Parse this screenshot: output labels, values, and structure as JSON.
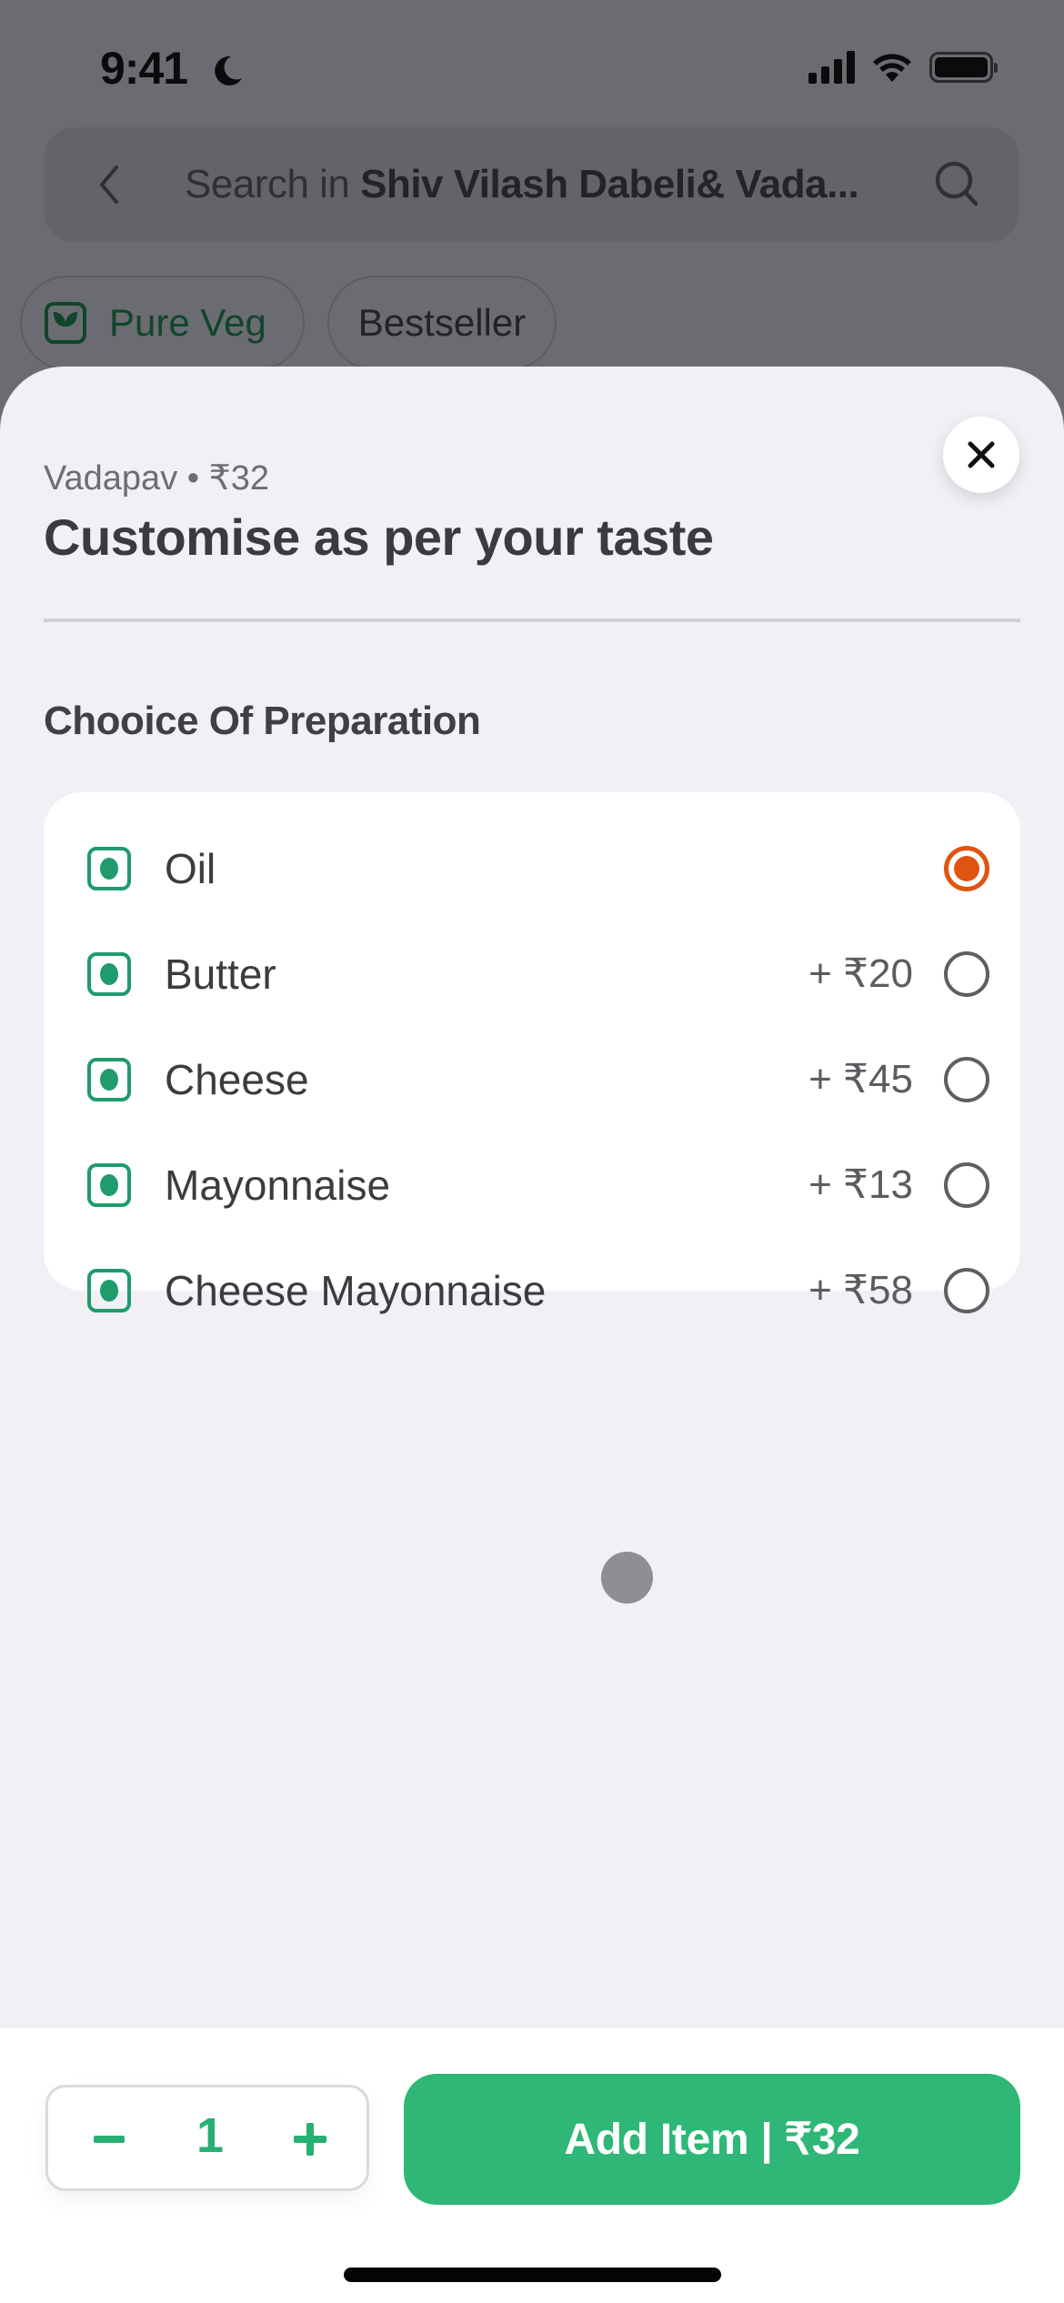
{
  "status_bar": {
    "time": "9:41",
    "icons": [
      "moon-icon",
      "signal-icon",
      "wifi-icon",
      "battery-icon"
    ]
  },
  "background_page": {
    "search": {
      "prefix": "Search in ",
      "restaurant": "Shiv Vilash Dabeli& Vada...",
      "back_icon": "chevron-left-icon",
      "search_icon": "magnifier-icon"
    },
    "filters": [
      {
        "label": "Pure Veg",
        "icon": "veg-leaf-icon"
      },
      {
        "label": "Bestseller"
      }
    ]
  },
  "sheet": {
    "item_name": "Vadapav",
    "separator": "•",
    "item_price": "₹32",
    "item_line": "Vadapav • ₹32",
    "title": "Customise as per your taste",
    "close_icon": "close-icon",
    "group": {
      "title": "Chooice Of  Preparation",
      "options": [
        {
          "label": "Oil",
          "price": "",
          "selected": true
        },
        {
          "label": "Butter",
          "price": "+ ₹20",
          "selected": false
        },
        {
          "label": "Cheese",
          "price": "+ ₹45",
          "selected": false
        },
        {
          "label": "Mayonnaise",
          "price": "+ ₹13",
          "selected": false
        },
        {
          "label": "Cheese Mayonnaise",
          "price": "+ ₹58",
          "selected": false
        }
      ]
    }
  },
  "footer": {
    "quantity": "1",
    "decrement_icon": "minus-icon",
    "increment_icon": "plus-icon",
    "add_button_label": "Add Item | ₹32"
  },
  "colors": {
    "accent_green": "#2eb776",
    "veg_green": "#1f9b6c",
    "selected_radio": "#e0540f",
    "sheet_bg": "#f0f0f5",
    "scrim": "#6b6c71"
  }
}
